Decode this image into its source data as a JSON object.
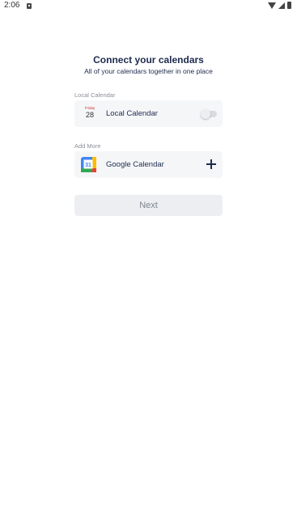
{
  "status_bar": {
    "time": "2:06",
    "notification_icon": "download-icon",
    "wifi_icon": "wifi-icon",
    "signal_icon": "cell-signal-icon",
    "battery_icon": "battery-icon"
  },
  "header": {
    "title": "Connect your calendars",
    "subtitle": "All of your calendars together in one place"
  },
  "local_section": {
    "label": "Local Calendar",
    "item": {
      "icon": "date-calendar-icon",
      "icon_day": "Friday",
      "icon_date": "28",
      "label": "Local Calendar",
      "toggle_on": false
    }
  },
  "add_more_section": {
    "label": "Add More",
    "item": {
      "icon": "google-calendar-icon",
      "icon_text": "31",
      "label": "Google Calendar",
      "action_icon": "plus-icon"
    }
  },
  "next_button": {
    "label": "Next",
    "enabled": false
  },
  "colors": {
    "text_primary": "#1d2b4f",
    "text_secondary": "#8a8f99",
    "card_background": "#f5f6f8",
    "button_disabled_bg": "#eceef1",
    "button_disabled_text": "#7d8390"
  }
}
